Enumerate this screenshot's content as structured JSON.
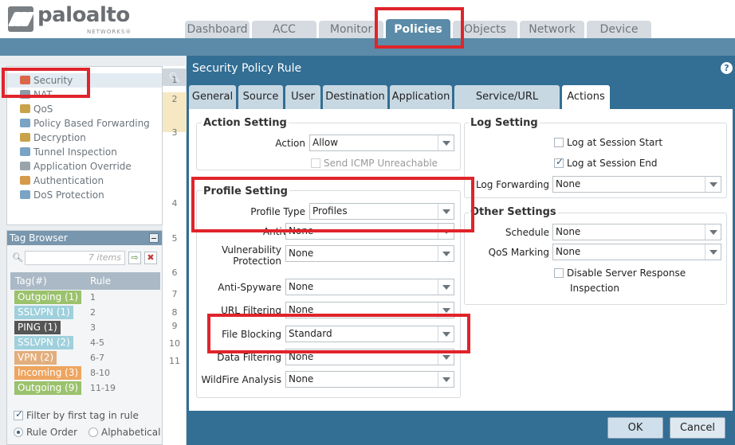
{
  "header": {
    "brand": "paloalto",
    "brand_sub": "NETWORKS®",
    "tabs": [
      {
        "label": "Dashboard"
      },
      {
        "label": "ACC"
      },
      {
        "label": "Monitor"
      },
      {
        "label": "Policies",
        "active": true
      },
      {
        "label": "Objects"
      },
      {
        "label": "Network"
      },
      {
        "label": "Device"
      }
    ]
  },
  "nav": {
    "items": [
      {
        "label": "Security",
        "icon": "security-icon",
        "selected": true
      },
      {
        "label": "NAT",
        "icon": "nat-icon"
      },
      {
        "label": "QoS",
        "icon": "qos-icon"
      },
      {
        "label": "Policy Based Forwarding",
        "icon": "pbf-icon"
      },
      {
        "label": "Decryption",
        "icon": "lock-icon"
      },
      {
        "label": "Tunnel Inspection",
        "icon": "tunnel-icon"
      },
      {
        "label": "Application Override",
        "icon": "app-override-icon"
      },
      {
        "label": "Authentication",
        "icon": "users-icon"
      },
      {
        "label": "DoS Protection",
        "icon": "shield-icon"
      }
    ]
  },
  "tag_browser": {
    "title": "Tag Browser",
    "search_placeholder": "7 items",
    "col_tag": "Tag(#)",
    "col_rule": "Rule",
    "rows": [
      {
        "tag": "Outgoing (1)",
        "rule": "1",
        "color": "#9bc26c"
      },
      {
        "tag": "SSLVPN (1)",
        "rule": "2",
        "color": "#9fd0dc"
      },
      {
        "tag": "PING (1)",
        "rule": "3",
        "color": "#555555"
      },
      {
        "tag": "SSLVPN (2)",
        "rule": "4-5",
        "color": "#9fd0dc"
      },
      {
        "tag": "VPN (2)",
        "rule": "6-7",
        "color": "#e2ae7c"
      },
      {
        "tag": "Incoming (3)",
        "rule": "8-10",
        "color": "#eea55f"
      },
      {
        "tag": "Outgoing (9)",
        "rule": "11-19",
        "color": "#9bc26c"
      }
    ],
    "filter_label": "Filter by first tag in rule",
    "order_label": "Rule Order",
    "alpha_label": "Alphabetical"
  },
  "rule_numbers": [
    "1",
    "2",
    "3",
    "4",
    "5",
    "6",
    "7",
    "8",
    "9",
    "10",
    "11"
  ],
  "dialog": {
    "title": "Security Policy Rule",
    "help": "?",
    "tabs": [
      {
        "label": "General"
      },
      {
        "label": "Source"
      },
      {
        "label": "User"
      },
      {
        "label": "Destination"
      },
      {
        "label": "Application"
      },
      {
        "label": "Service/URL Category"
      },
      {
        "label": "Actions",
        "active": true
      }
    ],
    "action_setting": {
      "title": "Action Setting",
      "action_label": "Action",
      "action_value": "Allow",
      "icmp_label": "Send ICMP Unreachable"
    },
    "profile_setting": {
      "title": "Profile Setting",
      "profile_type_label": "Profile Type",
      "profile_type_value": "Profiles",
      "antivirus_label": "Antivirus",
      "antivirus_value": "None",
      "vuln_label_1": "Vulnerability",
      "vuln_label_2": "Protection",
      "vuln_value": "None",
      "antispyware_label": "Anti-Spyware",
      "antispyware_value": "None",
      "url_label": "URL Filtering",
      "url_value": "None",
      "file_label": "File Blocking",
      "file_value": "Standard",
      "data_label": "Data Filtering",
      "data_value": "None",
      "wildfire_label": "WildFire Analysis",
      "wildfire_value": "None"
    },
    "log_setting": {
      "title": "Log Setting",
      "log_start_label": "Log at Session Start",
      "log_end_label": "Log at Session End",
      "forwarding_label": "Log Forwarding",
      "forwarding_value": "None"
    },
    "other_settings": {
      "title": "Other Settings",
      "schedule_label": "Schedule",
      "schedule_value": "None",
      "qos_label": "QoS Marking",
      "qos_value": "None",
      "dsri_label_1": "Disable Server Response",
      "dsri_label_2": "Inspection"
    },
    "ok": "OK",
    "cancel": "Cancel"
  },
  "colors": {
    "dialog_blue": "#336e94",
    "tab_active_blue": "#5b8ba8",
    "annotation_red": "#e0242b"
  }
}
